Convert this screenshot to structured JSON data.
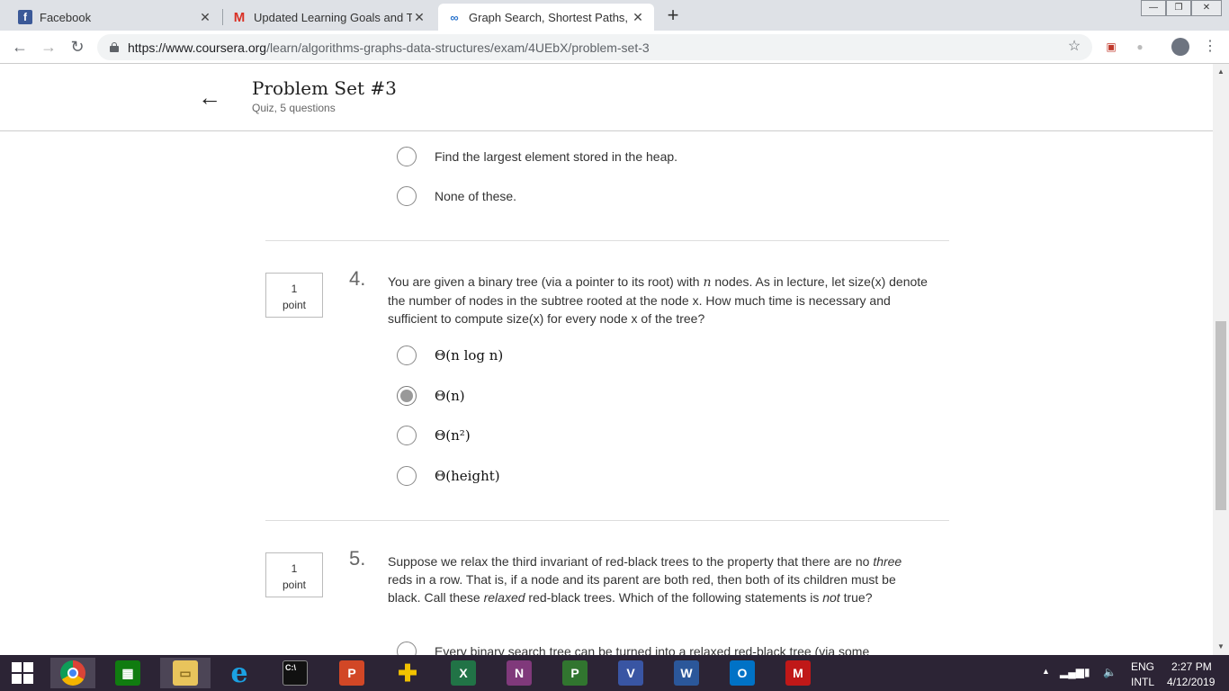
{
  "tabs": [
    {
      "title": "Facebook",
      "icon": "facebook-icon"
    },
    {
      "title": "Updated Learning Goals and Tim",
      "icon": "gmail-icon"
    },
    {
      "title": "Graph Search, Shortest Paths, and",
      "icon": "coursera-icon"
    }
  ],
  "url": {
    "base": "https://www.coursera.org",
    "path": "/learn/algorithms-graphs-data-structures/exam/4UEbX/problem-set-3"
  },
  "header": {
    "title": "Problem Set #3",
    "subtitle": "Quiz, 5 questions"
  },
  "prev_question_options": [
    {
      "label": "Find the largest element stored in the heap.",
      "selected": false
    },
    {
      "label": "None of these.",
      "selected": false
    }
  ],
  "q4": {
    "points": "1",
    "points_unit": "point",
    "number": "4.",
    "text_a": "You are given a binary tree (via a pointer to its root) with ",
    "var_n": "n",
    "text_b": " nodes. As in lecture, let size(x) denote the number of nodes in the subtree rooted at the node x. How much time is necessary and sufficient to compute size(x) for every node x of the tree?",
    "options": [
      {
        "label": "Θ(n log n)",
        "selected": false
      },
      {
        "label": "Θ(n)",
        "selected": true
      },
      {
        "label": "Θ(n²)",
        "selected": false
      },
      {
        "label": "Θ(height)",
        "selected": false
      }
    ]
  },
  "q5": {
    "points": "1",
    "points_unit": "point",
    "number": "5.",
    "text_a": "Suppose we relax the third invariant of red-black trees to the property that there are no ",
    "em_1": "three",
    "text_b": " reds in a row. That is, if a node and its parent are both red, then both of its children must be black. Call these ",
    "em_2": "relaxed",
    "text_c": " red-black trees. Which of the following statements is ",
    "em_3": "not",
    "text_d": " true?",
    "first_option": "Every binary search tree can be turned into a relaxed red-black tree (via some"
  },
  "taskbar": {
    "lang_top": "ENG",
    "lang_bottom": "INTL",
    "time": "2:27 PM",
    "date": "4/12/2019"
  }
}
